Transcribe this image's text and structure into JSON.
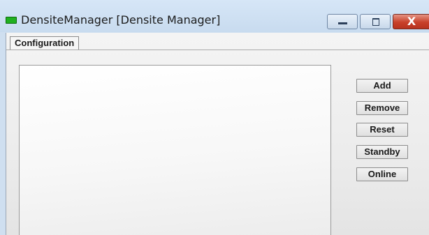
{
  "window": {
    "title": "DensiteManager [Densite Manager]",
    "close_symbol": "X"
  },
  "tabs": [
    {
      "label": "Configuration",
      "selected": true
    }
  ],
  "buttons": {
    "add": "Add",
    "remove": "Remove",
    "reset": "Reset",
    "standby": "Standby",
    "online": "Online"
  },
  "colors": {
    "title_icon": "#20b020",
    "close_button": "#c8402a"
  }
}
